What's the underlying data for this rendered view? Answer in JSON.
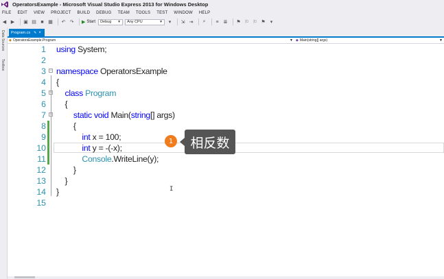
{
  "window": {
    "title": "OperatorsExample - Microsoft Visual Studio Express 2013 for Windows Desktop",
    "logo_icon": "vs-infinity-logo"
  },
  "menu": [
    "FILE",
    "EDIT",
    "VIEW",
    "PROJECT",
    "BUILD",
    "DEBUG",
    "TEAM",
    "TOOLS",
    "TEST",
    "WINDOW",
    "HELP"
  ],
  "toolbar": {
    "start_label": "Start",
    "config_value": "Debug",
    "platform_value": "Any CPU"
  },
  "side_tabs": [
    "Data Sources",
    "Toolbox"
  ],
  "document_tab": {
    "label": "Program.cs",
    "pin_icon": "pin-icon",
    "close_icon": "close-icon"
  },
  "navigation": {
    "left": "OperatorsExample.Program",
    "right": "Main(string[] args)"
  },
  "code_lines": [
    {
      "n": "1",
      "tokens": [
        {
          "t": "using ",
          "c": "kw"
        },
        {
          "t": "System;",
          "c": "plain"
        }
      ]
    },
    {
      "n": "2",
      "tokens": []
    },
    {
      "n": "3",
      "tokens": [
        {
          "t": "namespace ",
          "c": "kw"
        },
        {
          "t": "OperatorsExample",
          "c": "plain"
        }
      ]
    },
    {
      "n": "4",
      "tokens": [
        {
          "t": "{",
          "c": "plain"
        }
      ]
    },
    {
      "n": "5",
      "tokens": [
        {
          "t": "    class ",
          "c": "kw"
        },
        {
          "t": "Program",
          "c": "type"
        }
      ]
    },
    {
      "n": "6",
      "tokens": [
        {
          "t": "    {",
          "c": "plain"
        }
      ]
    },
    {
      "n": "7",
      "tokens": [
        {
          "t": "        static ",
          "c": "kw"
        },
        {
          "t": "void ",
          "c": "kw"
        },
        {
          "t": "Main(",
          "c": "plain"
        },
        {
          "t": "string",
          "c": "kw"
        },
        {
          "t": "[] args)",
          "c": "plain"
        }
      ]
    },
    {
      "n": "8",
      "tokens": [
        {
          "t": "        {",
          "c": "plain"
        }
      ]
    },
    {
      "n": "9",
      "tokens": [
        {
          "t": "            int ",
          "c": "kw"
        },
        {
          "t": "x = 100;",
          "c": "plain"
        }
      ]
    },
    {
      "n": "10",
      "tokens": [
        {
          "t": "            int ",
          "c": "kw"
        },
        {
          "t": "y = -(-x);",
          "c": "plain"
        }
      ]
    },
    {
      "n": "11",
      "tokens": [
        {
          "t": "            Console",
          "c": "type"
        },
        {
          "t": ".WriteLine(y);",
          "c": "plain"
        }
      ]
    },
    {
      "n": "12",
      "tokens": [
        {
          "t": "        }",
          "c": "plain"
        }
      ]
    },
    {
      "n": "13",
      "tokens": [
        {
          "t": "    }",
          "c": "plain"
        }
      ]
    },
    {
      "n": "14",
      "tokens": [
        {
          "t": "}",
          "c": "plain"
        }
      ]
    },
    {
      "n": "15",
      "tokens": []
    }
  ],
  "annotation": {
    "number": "1",
    "text": "相反数",
    "dot_color": "#f07c1e",
    "box_color": "#555555"
  },
  "colors": {
    "keyword": "#0000ff",
    "type": "#2b91af",
    "line_number": "#2b91af",
    "change_bar": "#57a64a",
    "tab_accent": "#007acc"
  }
}
